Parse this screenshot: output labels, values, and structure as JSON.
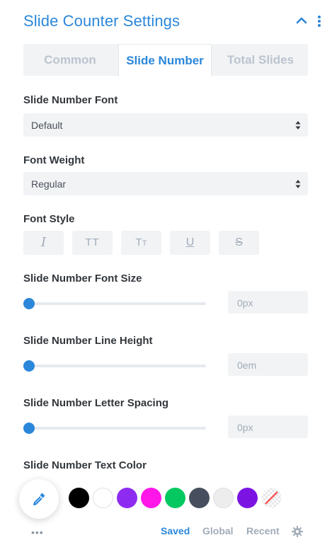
{
  "header": {
    "title": "Slide Counter Settings",
    "collapse_icon": "chevron-up-icon",
    "menu_icon": "kebab-menu-icon"
  },
  "tabs": [
    {
      "label": "Common",
      "active": false
    },
    {
      "label": "Slide Number",
      "active": true
    },
    {
      "label": "Total Slides",
      "active": false
    }
  ],
  "fields": {
    "font": {
      "label": "Slide Number Font",
      "value": "Default"
    },
    "weight": {
      "label": "Font Weight",
      "value": "Regular"
    },
    "style": {
      "label": "Font Style",
      "buttons": [
        "italic-icon",
        "uppercase-icon",
        "capitalize-icon",
        "underline-icon",
        "strikethrough-icon"
      ]
    },
    "font_size": {
      "label": "Slide Number Font Size",
      "value": "0px",
      "level": 0
    },
    "line_height": {
      "label": "Slide Number Line Height",
      "value": "0em",
      "level": 0
    },
    "letter_spacing": {
      "label": "Slide Number Letter Spacing",
      "value": "0px",
      "level": 0
    },
    "text_color": {
      "label": "Slide Number Text Color"
    }
  },
  "color_picker": {
    "icon": "eyedropper-icon",
    "swatches": [
      "#000000",
      "#ffffff",
      "#8d2cf0",
      "#ff16e8",
      "#05c860",
      "#474f5e",
      "#ededed",
      "#7b14e3"
    ],
    "none_icon": "no-color-icon",
    "more_icon": "more-dots-icon"
  },
  "footer": {
    "saved": "Saved",
    "global": "Global",
    "recent": "Recent",
    "settings_icon": "gear-icon"
  },
  "colors": {
    "accent": "#2b87da",
    "field_bg": "#f1f3f5",
    "muted": "#a2acb8"
  }
}
